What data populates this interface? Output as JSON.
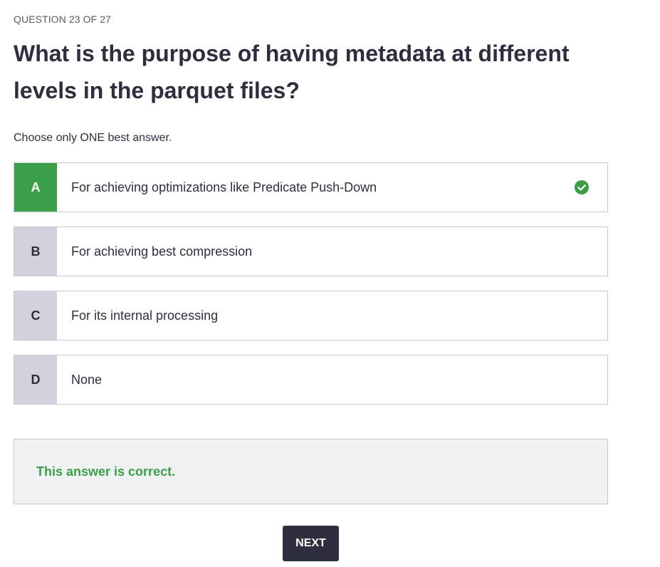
{
  "header": {
    "progress": "QUESTION 23 OF 27"
  },
  "question": {
    "text": "What is the purpose of having metadata at different levels in the parquet files?",
    "instruction": "Choose only ONE best answer."
  },
  "options": [
    {
      "letter": "A",
      "text": "For achieving optimizations like Predicate Push-Down",
      "selected": true,
      "correct": true
    },
    {
      "letter": "B",
      "text": "For achieving best compression",
      "selected": false
    },
    {
      "letter": "C",
      "text": "For its internal processing",
      "selected": false
    },
    {
      "letter": "D",
      "text": "None",
      "selected": false
    }
  ],
  "feedback": {
    "message": "This answer is correct."
  },
  "actions": {
    "next_label": "NEXT"
  },
  "icons": {
    "correct": "check-circle-icon"
  },
  "colors": {
    "correct_green": "#3b9f4a",
    "dark": "#2d2f3f",
    "letter_bg": "#d0d3dc",
    "feedback_bg": "#f0f1f3"
  }
}
